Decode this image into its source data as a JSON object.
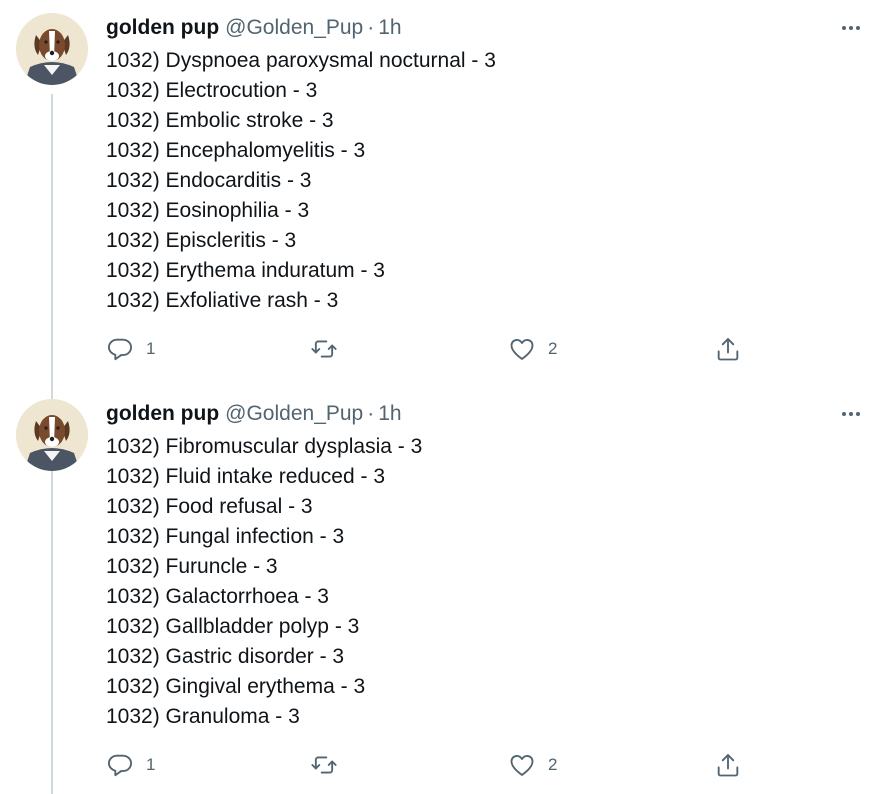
{
  "tweets": [
    {
      "display_name": "golden pup",
      "handle": "@Golden_Pup",
      "separator": "·",
      "time": "1h",
      "lines": [
        "1032) Dyspnoea paroxysmal nocturnal - 3",
        "1032) Electrocution - 3",
        "1032) Embolic stroke - 3",
        "1032) Encephalomyelitis - 3",
        "1032) Endocarditis - 3",
        "1032) Eosinophilia - 3",
        "1032) Episcleritis - 3",
        "1032) Erythema induratum - 3",
        "1032) Exfoliative rash - 3"
      ],
      "reply_count": "1",
      "retweet_count": "",
      "like_count": "2"
    },
    {
      "display_name": "golden pup",
      "handle": "@Golden_Pup",
      "separator": "·",
      "time": "1h",
      "lines": [
        "1032) Fibromuscular dysplasia - 3",
        "1032) Fluid intake reduced - 3",
        "1032) Food refusal - 3",
        "1032) Fungal infection - 3",
        "1032) Furuncle - 3",
        "1032) Galactorrhoea - 3",
        "1032) Gallbladder polyp - 3",
        "1032) Gastric disorder - 3",
        "1032) Gingival erythema - 3",
        "1032) Granuloma - 3"
      ],
      "reply_count": "1",
      "retweet_count": "",
      "like_count": "2"
    }
  ],
  "icons": {
    "reply": "reply-icon",
    "retweet": "retweet-icon",
    "like": "heart-icon",
    "share": "share-icon",
    "more": "more-icon",
    "avatar": "dog-avatar"
  },
  "colors": {
    "text": "#0f1419",
    "secondary": "#536471",
    "thread_line": "#cfd9de"
  }
}
